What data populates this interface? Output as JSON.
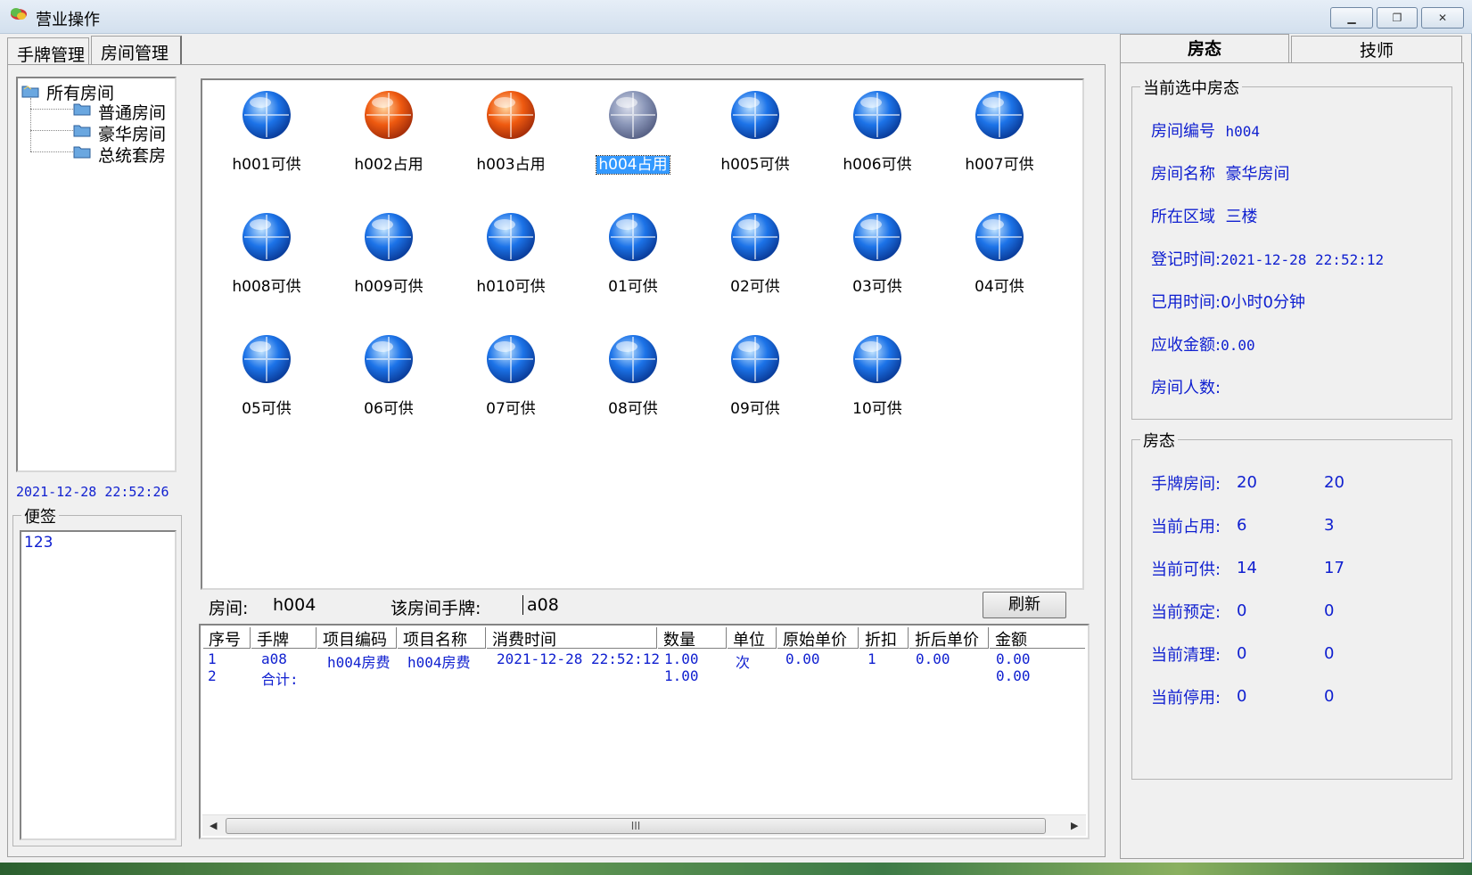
{
  "window": {
    "title": "营业操作",
    "controls": [
      "minimize",
      "maximize",
      "close"
    ]
  },
  "main_tabs": [
    {
      "label": "手牌管理"
    },
    {
      "label": "房间管理"
    }
  ],
  "tree": {
    "root": "所有房间",
    "children": [
      "普通房间",
      "豪华房间",
      "总统套房"
    ]
  },
  "clock": "2021-12-28 22:52:26",
  "memo": {
    "label": "便签",
    "text": "123"
  },
  "rooms": [
    {
      "label": "h001可供",
      "status": "available"
    },
    {
      "label": "h002占用",
      "status": "occupied"
    },
    {
      "label": "h003占用",
      "status": "occupied"
    },
    {
      "label": "h004占用",
      "status": "selected"
    },
    {
      "label": "h005可供",
      "status": "available"
    },
    {
      "label": "h006可供",
      "status": "available"
    },
    {
      "label": "h007可供",
      "status": "available"
    },
    {
      "label": "h008可供",
      "status": "available"
    },
    {
      "label": "h009可供",
      "status": "available"
    },
    {
      "label": "h010可供",
      "status": "available"
    },
    {
      "label": "01可供",
      "status": "available"
    },
    {
      "label": "02可供",
      "status": "available"
    },
    {
      "label": "03可供",
      "status": "available"
    },
    {
      "label": "04可供",
      "status": "available"
    },
    {
      "label": "05可供",
      "status": "available"
    },
    {
      "label": "06可供",
      "status": "available"
    },
    {
      "label": "07可供",
      "status": "available"
    },
    {
      "label": "08可供",
      "status": "available"
    },
    {
      "label": "09可供",
      "status": "available"
    },
    {
      "label": "10可供",
      "status": "available"
    }
  ],
  "room_info": {
    "room_label": "房间:",
    "room_value": "h004",
    "card_label": "该房间手牌:",
    "card_value": "a08",
    "refresh": "刷新"
  },
  "grid": {
    "headers": [
      "序号",
      "手牌",
      "项目编码",
      "项目名称",
      "消费时间",
      "数量",
      "单位",
      "原始单价",
      "折扣",
      "折后单价",
      "金额"
    ],
    "rows": [
      [
        "1",
        "a08",
        "h004房费",
        "h004房费",
        "2021-12-28 22:52:12",
        "1.00",
        "次",
        "0.00",
        "1",
        "0.00",
        "0.00"
      ],
      [
        "2",
        "合计:",
        "",
        "",
        "",
        "1.00",
        "",
        "",
        "",
        "",
        "0.00"
      ]
    ],
    "scroll_grip": "III"
  },
  "right_tabs": [
    {
      "label": "房态"
    },
    {
      "label": "技师"
    }
  ],
  "current_room": {
    "group_label": "当前选中房态",
    "room_no": {
      "label": "房间编号",
      "value": "h004"
    },
    "room_name": {
      "label": "房间名称",
      "value": "豪华房间"
    },
    "area": {
      "label": "所在区域",
      "value": "三楼"
    },
    "checkin": {
      "label": "登记时间:",
      "value": "2021-12-28 22:52:12"
    },
    "used_time": {
      "label": "已用时间:",
      "value": "0小时0分钟"
    },
    "amount_due": {
      "label": "应收金额:",
      "value": "0.00"
    },
    "guests": {
      "label": "房间人数:",
      "value": ""
    }
  },
  "room_status": {
    "group_label": "房态",
    "rows": [
      {
        "label": "手牌房间:",
        "a": "20",
        "b": "20"
      },
      {
        "label": "当前占用:",
        "a": "6",
        "b": "3"
      },
      {
        "label": "当前可供:",
        "a": "14",
        "b": "17"
      },
      {
        "label": "当前预定:",
        "a": "0",
        "b": "0"
      },
      {
        "label": "当前清理:",
        "a": "0",
        "b": "0"
      },
      {
        "label": "当前停用:",
        "a": "0",
        "b": "0"
      }
    ]
  },
  "colors": {
    "link_blue": "#1020d0",
    "available_ball": "#1c73e8",
    "occupied_ball": "#ef5a10",
    "selected_ball": "#8a96b8",
    "selection_highlight": "#3399ff"
  }
}
